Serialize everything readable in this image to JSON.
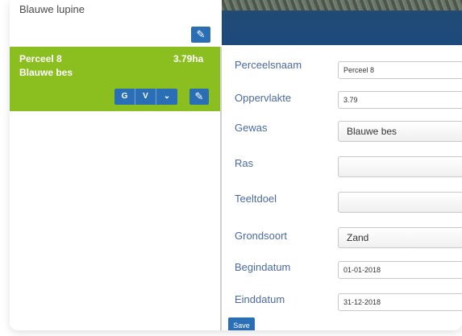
{
  "list": {
    "top_item": {
      "name": "Blauwe lupine"
    },
    "selected_item": {
      "name": "Perceel 8",
      "crop": "Blauwe bes",
      "area": "3.79ha",
      "buttons": {
        "g": "G",
        "v": "V",
        "chevron": "⌄"
      }
    }
  },
  "form": {
    "labels": {
      "name": "Perceelsnaam",
      "area": "Oppervlakte",
      "crop": "Gewas",
      "variety": "Ras",
      "purpose": "Teeltdoel",
      "soil": "Grondsoort",
      "start": "Begindatum",
      "end": "Einddatum"
    },
    "values": {
      "name": "Perceel 8",
      "area": "3.79",
      "crop": "Blauwe bes",
      "variety": "",
      "purpose": "",
      "soil": "Zand",
      "start": "01-01-2018",
      "end": "31-12-2018"
    },
    "save_label": "Save"
  },
  "icons": {
    "edit": "pencil-icon"
  },
  "colors": {
    "selected_bg": "#8bbf1f",
    "button_blue": "#2a6fb5",
    "label_blue": "#4b6aa0"
  }
}
